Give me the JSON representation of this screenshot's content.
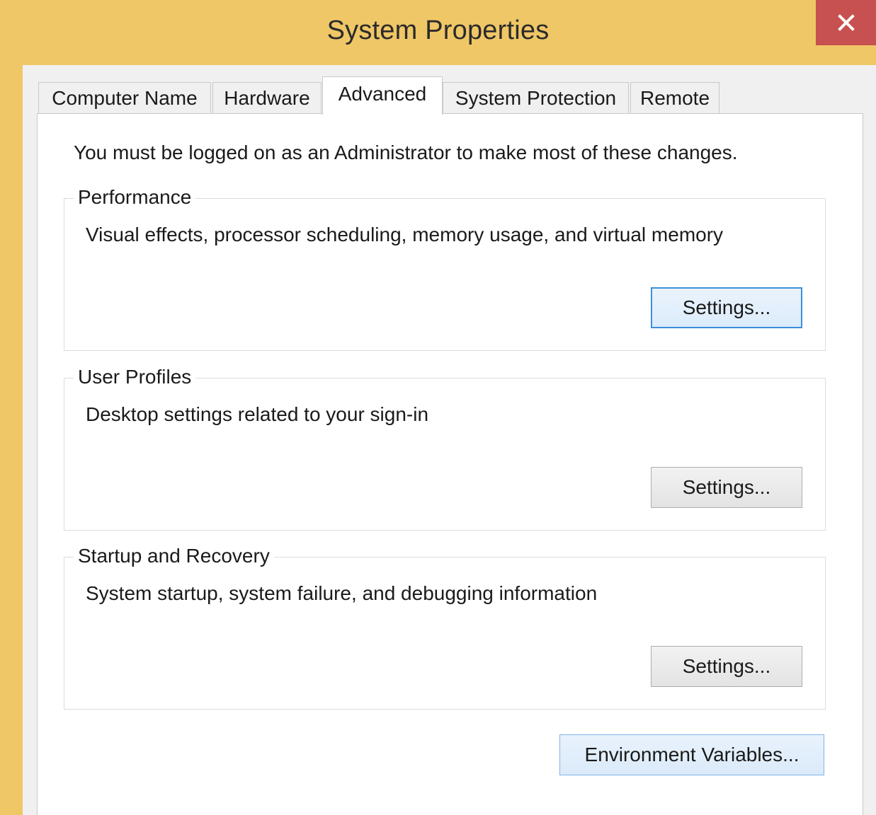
{
  "window": {
    "title": "System Properties",
    "close_glyph": "✕"
  },
  "tabs": [
    {
      "label": "Computer Name",
      "active": false
    },
    {
      "label": "Hardware",
      "active": false
    },
    {
      "label": "Advanced",
      "active": true
    },
    {
      "label": "System Protection",
      "active": false
    },
    {
      "label": "Remote",
      "active": false
    }
  ],
  "advanced": {
    "admin_note": "You must be logged on as an Administrator to make most of these changes.",
    "performance": {
      "title": "Performance",
      "description": "Visual effects, processor scheduling, memory usage, and virtual memory",
      "button_label": "Settings..."
    },
    "user_profiles": {
      "title": "User Profiles",
      "description": "Desktop settings related to your sign-in",
      "button_label": "Settings..."
    },
    "startup_recovery": {
      "title": "Startup and Recovery",
      "description": "System startup, system failure, and debugging information",
      "button_label": "Settings..."
    },
    "env_button_label": "Environment Variables..."
  },
  "colors": {
    "titlebar": "#f0c766",
    "close_button": "#c75050",
    "focus_border": "#3c8fd9"
  }
}
